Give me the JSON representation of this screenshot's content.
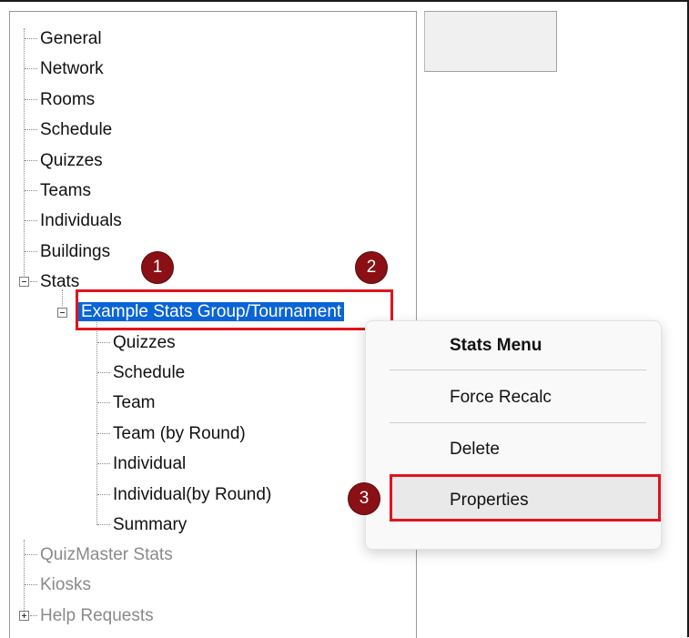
{
  "tree": {
    "items": [
      {
        "label": "General"
      },
      {
        "label": "Network"
      },
      {
        "label": "Rooms"
      },
      {
        "label": "Schedule"
      },
      {
        "label": "Quizzes"
      },
      {
        "label": "Teams"
      },
      {
        "label": "Individuals"
      },
      {
        "label": "Buildings"
      },
      {
        "label": "Stats"
      },
      {
        "label": "Example Stats Group/Tournament"
      },
      {
        "label": "Quizzes"
      },
      {
        "label": "Schedule"
      },
      {
        "label": "Team"
      },
      {
        "label": "Team (by Round)"
      },
      {
        "label": "Individual"
      },
      {
        "label": "Individual(by Round)"
      },
      {
        "label": "Summary"
      },
      {
        "label": "QuizMaster Stats"
      },
      {
        "label": "Kiosks"
      },
      {
        "label": "Help Requests"
      }
    ]
  },
  "context_menu": {
    "title": "Stats Menu",
    "items": [
      "Force Recalc",
      "Delete",
      "Properties"
    ]
  },
  "annotations": [
    "1",
    "2",
    "3"
  ],
  "colors": {
    "highlight_red": "#e0141e",
    "badge": "#8b1015",
    "selection_blue": "#0a64d6"
  }
}
